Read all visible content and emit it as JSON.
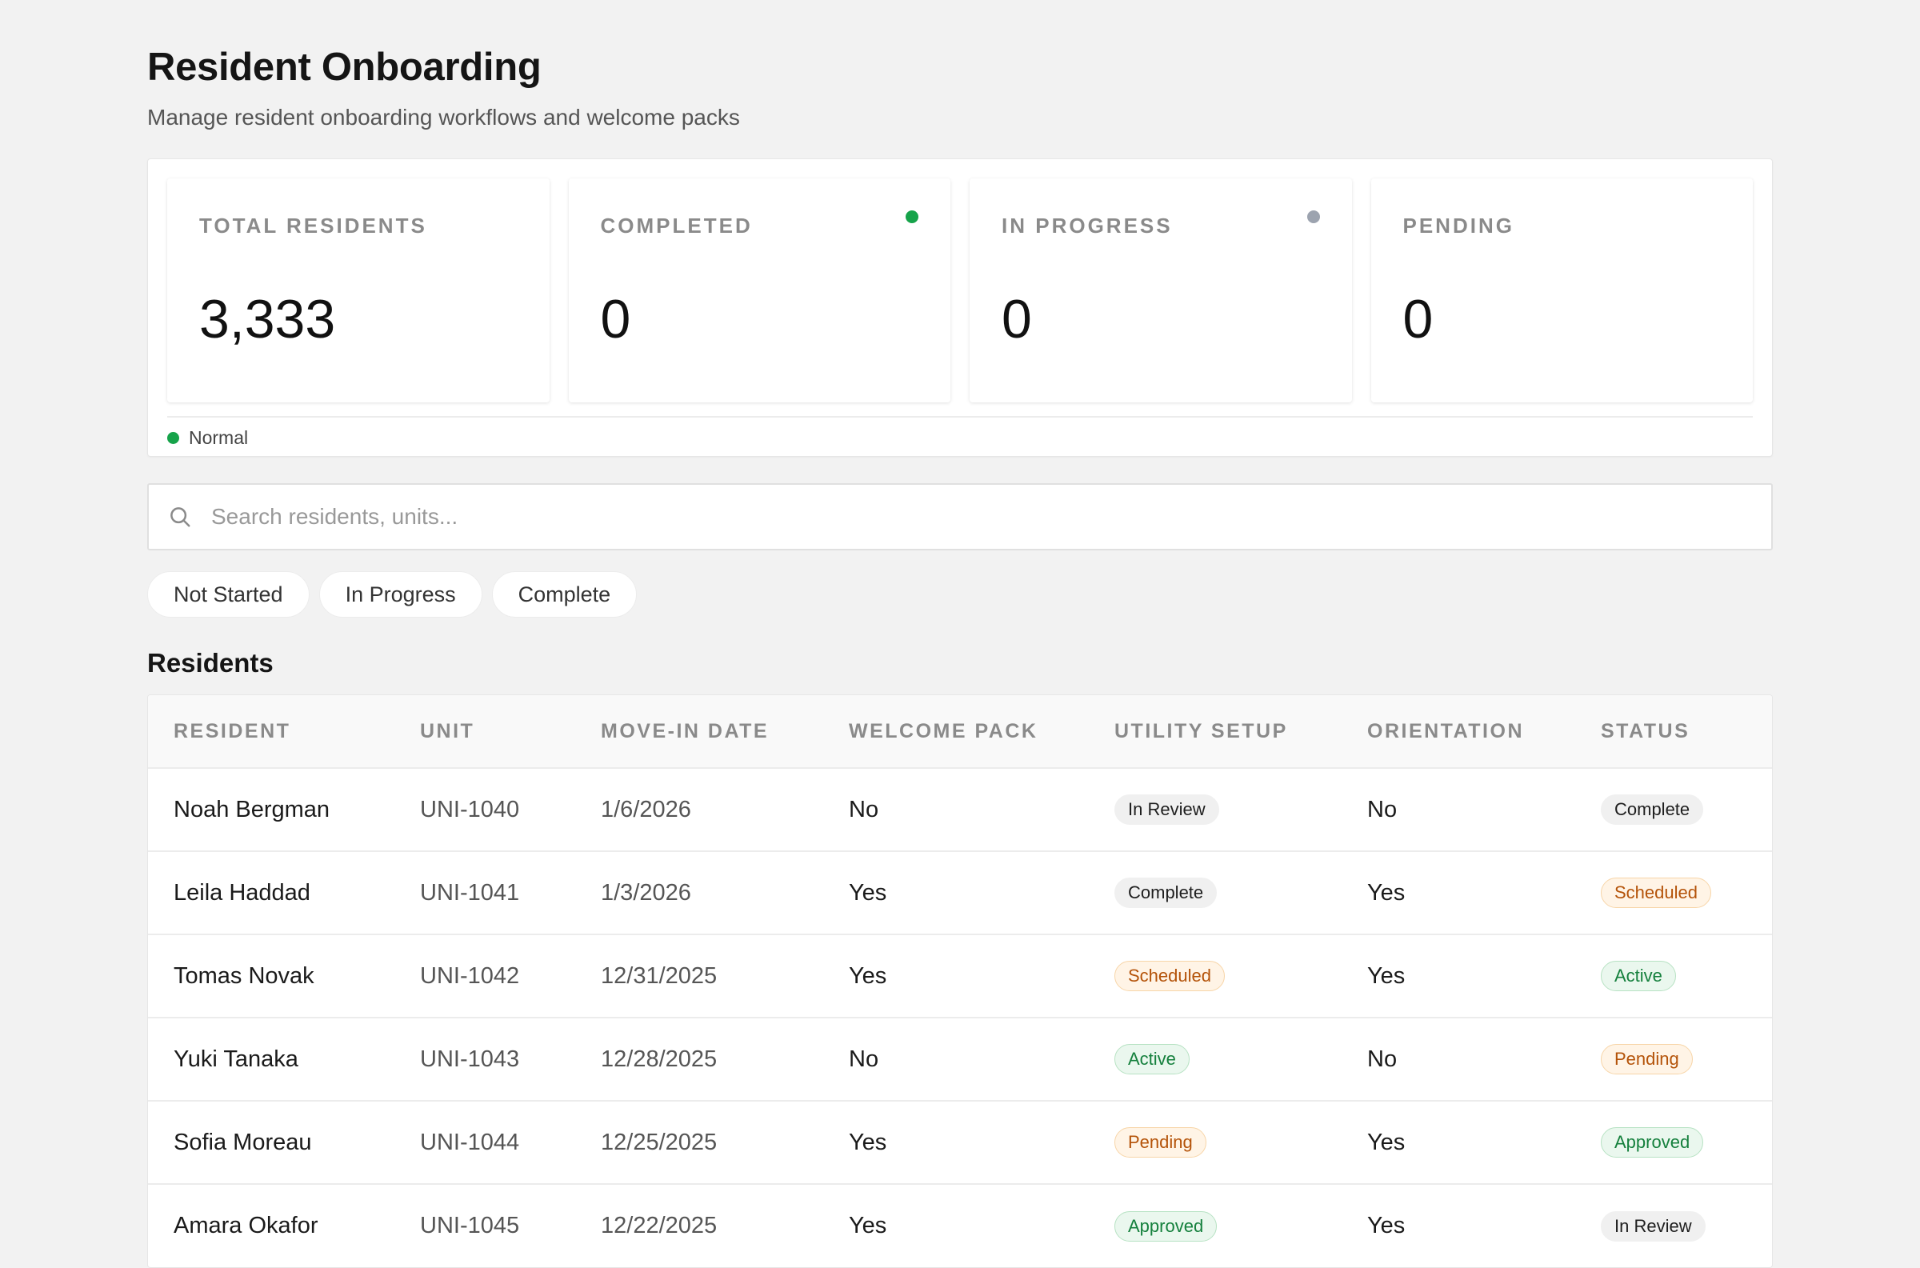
{
  "header": {
    "title": "Resident Onboarding",
    "subtitle": "Manage resident onboarding workflows and welcome packs"
  },
  "kpis": [
    {
      "label": "TOTAL RESIDENTS",
      "value": "3,333",
      "dot": null
    },
    {
      "label": "COMPLETED",
      "value": "0",
      "dot": "#16a34a"
    },
    {
      "label": "IN PROGRESS",
      "value": "0",
      "dot": "#9ca3af"
    },
    {
      "label": "PENDING",
      "value": "0",
      "dot": null
    }
  ],
  "status": {
    "label": "Normal",
    "color": "#16a34a"
  },
  "search": {
    "placeholder": "Search residents, units..."
  },
  "filters": [
    "Not Started",
    "In Progress",
    "Complete"
  ],
  "table": {
    "title": "Residents",
    "columns": [
      "RESIDENT",
      "UNIT",
      "MOVE-IN DATE",
      "WELCOME PACK",
      "UTILITY SETUP",
      "ORIENTATION",
      "STATUS"
    ],
    "rows": [
      {
        "resident": "Noah Bergman",
        "unit": "UNI-1040",
        "move_in": "1/6/2026",
        "welcome_pack": "No",
        "utility": "In Review",
        "orientation": "No",
        "status": "Complete"
      },
      {
        "resident": "Leila Haddad",
        "unit": "UNI-1041",
        "move_in": "1/3/2026",
        "welcome_pack": "Yes",
        "utility": "Complete",
        "orientation": "Yes",
        "status": "Scheduled"
      },
      {
        "resident": "Tomas Novak",
        "unit": "UNI-1042",
        "move_in": "12/31/2025",
        "welcome_pack": "Yes",
        "utility": "Scheduled",
        "orientation": "Yes",
        "status": "Active"
      },
      {
        "resident": "Yuki Tanaka",
        "unit": "UNI-1043",
        "move_in": "12/28/2025",
        "welcome_pack": "No",
        "utility": "Active",
        "orientation": "No",
        "status": "Pending"
      },
      {
        "resident": "Sofia Moreau",
        "unit": "UNI-1044",
        "move_in": "12/25/2025",
        "welcome_pack": "Yes",
        "utility": "Pending",
        "orientation": "Yes",
        "status": "Approved"
      },
      {
        "resident": "Amara Okafor",
        "unit": "UNI-1045",
        "move_in": "12/22/2025",
        "welcome_pack": "Yes",
        "utility": "Approved",
        "orientation": "Yes",
        "status": "In Review"
      }
    ]
  },
  "badge_colors": {
    "In Review": "gray",
    "Complete": "gray",
    "Scheduled": "orange",
    "Pending": "orange",
    "Active": "green",
    "Approved": "green"
  }
}
